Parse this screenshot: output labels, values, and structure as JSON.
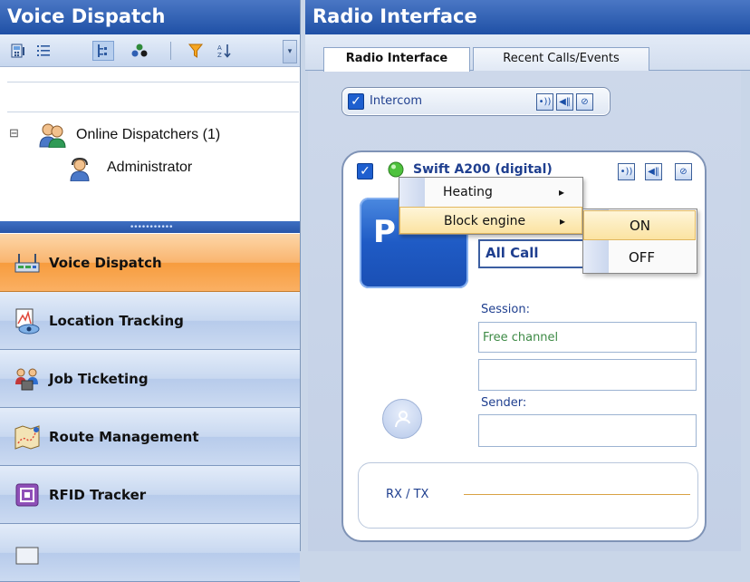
{
  "left_panel": {
    "title": "Voice Dispatch",
    "tree": {
      "group_label": "Online Dispatchers (1)",
      "group_toggle": "⊟",
      "child_label": "Administrator"
    },
    "nav": [
      {
        "label": "Voice Dispatch",
        "icon": "voice-dispatch-icon",
        "active": true
      },
      {
        "label": "Location Tracking",
        "icon": "location-tracking-icon",
        "active": false
      },
      {
        "label": "Job Ticketing",
        "icon": "job-ticketing-icon",
        "active": false
      },
      {
        "label": "Route Management",
        "icon": "route-management-icon",
        "active": false
      },
      {
        "label": "RFID Tracker",
        "icon": "rfid-tracker-icon",
        "active": false
      }
    ]
  },
  "right_panel": {
    "title": "Radio Interface",
    "tabs": [
      {
        "label": "Radio Interface",
        "active": true
      },
      {
        "label": "Recent Calls/Events",
        "active": false
      }
    ],
    "intercom": {
      "label": "Intercom",
      "checked": true
    },
    "radio": {
      "name": "Swift A200 (digital)",
      "ptt_label": "P",
      "talkgroup": "All Call",
      "session_label": "Session:",
      "session_value": "Free channel",
      "sender_label": "Sender:",
      "rxtx_label": "RX / TX"
    },
    "context_menu": {
      "items": [
        {
          "label": "Heating",
          "arrow": "▸"
        },
        {
          "label": "Block engine",
          "arrow": "▸"
        }
      ],
      "submenu": [
        {
          "label": "ON"
        },
        {
          "label": "OFF"
        }
      ]
    }
  },
  "colors": {
    "title_bar": "#1f50a6",
    "nav_active": "#f79c3e",
    "accent_blue": "#1e5fcf",
    "session_text": "#3d8a45"
  }
}
